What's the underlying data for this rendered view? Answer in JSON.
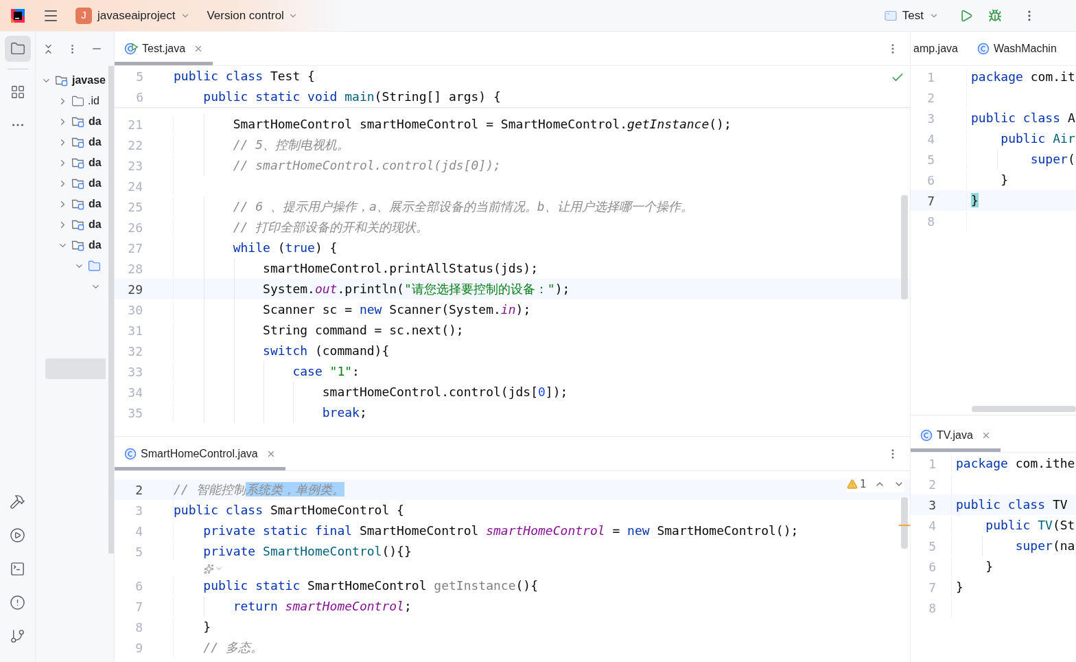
{
  "toolbar": {
    "project_badge": "J",
    "project": "javaseaiproject",
    "vcs": "Version control",
    "run_config": "Test"
  },
  "tool_windows": [
    {
      "kind": "project",
      "selected": true
    },
    {
      "kind": "structure",
      "selected": false
    },
    {
      "kind": "more",
      "selected": false
    }
  ],
  "bottom_tools": [
    {
      "kind": "build"
    },
    {
      "kind": "services"
    },
    {
      "kind": "terminal"
    },
    {
      "kind": "problems"
    },
    {
      "kind": "git"
    }
  ],
  "project_tree": {
    "highlight_row": true,
    "items": [
      {
        "label": "javase",
        "kind": "module",
        "expanded": true,
        "children": [
          {
            "label": ".id",
            "kind": "folder",
            "expanded": false
          },
          {
            "label": "da",
            "kind": "module",
            "expanded": false
          },
          {
            "label": "da",
            "kind": "module",
            "expanded": false
          },
          {
            "label": "da",
            "kind": "module",
            "expanded": false
          },
          {
            "label": "da",
            "kind": "module",
            "expanded": false
          },
          {
            "label": "da",
            "kind": "module",
            "expanded": false
          },
          {
            "label": "da",
            "kind": "module",
            "expanded": false
          },
          {
            "label": "da",
            "kind": "module",
            "expanded": true,
            "children": [
              {
                "kind": "source-folder",
                "expanded": true,
                "children": [
                  {
                    "kind": "chevron-only",
                    "expanded": true
                  }
                ]
              }
            ]
          }
        ]
      }
    ]
  },
  "editors": [
    {
      "tabs": [
        {
          "title": "Test.java",
          "kind": "runnable-class",
          "closable": true,
          "selected": true
        }
      ],
      "status": {
        "kind": "ok"
      },
      "sticky_lines": [
        {
          "number": "5",
          "tokens": [
            {
              "text": "public class ",
              "kind": "keyword"
            },
            {
              "text": "Test {",
              "kind": "plain"
            }
          ]
        },
        {
          "number": "6",
          "tokens": [
            {
              "text": "    public static void ",
              "kind": "keyword"
            },
            {
              "text": "main",
              "kind": "declaration"
            },
            {
              "text": "(String[] args) {",
              "kind": "plain"
            }
          ]
        }
      ],
      "lines": [
        {
          "kind": "code",
          "number": "21",
          "current": false,
          "tokens": [
            {
              "text": "        SmartHomeControl smartHomeControl = SmartHomeControl.",
              "kind": "plain"
            },
            {
              "text": "getInstance",
              "kind": "static-call"
            },
            {
              "text": "();",
              "kind": "plain"
            }
          ]
        },
        {
          "kind": "code",
          "number": "22",
          "current": false,
          "tokens": [
            {
              "text": "        // 5、控制电视机。",
              "kind": "comment"
            }
          ]
        },
        {
          "kind": "code",
          "number": "23",
          "current": false,
          "tokens": [
            {
              "text": "        // smartHomeControl.control(jds[0]);",
              "kind": "comment"
            }
          ]
        },
        {
          "kind": "code",
          "number": "24",
          "current": false
        },
        {
          "kind": "code",
          "number": "25",
          "current": false,
          "tokens": [
            {
              "text": "        // 6 、提示用户操作，a、展示全部设备的当前情况。b、让用户选择哪一个操作。",
              "kind": "comment"
            }
          ]
        },
        {
          "kind": "code",
          "number": "26",
          "current": false,
          "tokens": [
            {
              "text": "        // 打印全部设备的开和关的现状。",
              "kind": "comment"
            }
          ]
        },
        {
          "kind": "code",
          "number": "27",
          "current": false,
          "tokens": [
            {
              "text": "        while ",
              "kind": "keyword"
            },
            {
              "text": "(",
              "kind": "plain"
            },
            {
              "text": "true",
              "kind": "keyword"
            },
            {
              "text": ") {",
              "kind": "plain"
            }
          ]
        },
        {
          "kind": "code",
          "number": "28",
          "current": false,
          "tokens": [
            {
              "text": "            smartHomeControl.printAllStatus(jds);",
              "kind": "plain"
            }
          ]
        },
        {
          "kind": "code",
          "number": "29",
          "current": true,
          "tokens": [
            {
              "text": "            System.",
              "kind": "plain"
            },
            {
              "text": "out",
              "kind": "field"
            },
            {
              "text": ".println(",
              "kind": "plain"
            },
            {
              "text": "\"请您选择要控制的设备：\"",
              "kind": "string"
            },
            {
              "text": ");",
              "kind": "plain"
            }
          ]
        },
        {
          "kind": "code",
          "number": "30",
          "current": false,
          "tokens": [
            {
              "text": "            Scanner sc = ",
              "kind": "plain"
            },
            {
              "text": "new ",
              "kind": "keyword"
            },
            {
              "text": "Scanner(System.",
              "kind": "plain"
            },
            {
              "text": "in",
              "kind": "field"
            },
            {
              "text": ");",
              "kind": "plain"
            }
          ]
        },
        {
          "kind": "code",
          "number": "31",
          "current": false,
          "tokens": [
            {
              "text": "            String command = sc.next();",
              "kind": "plain"
            }
          ]
        },
        {
          "kind": "code",
          "number": "32",
          "current": false,
          "tokens": [
            {
              "text": "            switch ",
              "kind": "keyword"
            },
            {
              "text": "(command){",
              "kind": "plain"
            }
          ]
        },
        {
          "kind": "code",
          "number": "33",
          "current": false,
          "tokens": [
            {
              "text": "                case ",
              "kind": "keyword"
            },
            {
              "text": "\"1\"",
              "kind": "string"
            },
            {
              "text": ":",
              "kind": "plain"
            }
          ]
        },
        {
          "kind": "code",
          "number": "34",
          "current": false,
          "tokens": [
            {
              "text": "                    smartHomeControl.control(jds[",
              "kind": "plain"
            },
            {
              "text": "0",
              "kind": "number"
            },
            {
              "text": "]);",
              "kind": "plain"
            }
          ]
        },
        {
          "kind": "code",
          "number": "35",
          "current": false,
          "tokens": [
            {
              "text": "                    break",
              "kind": "keyword"
            },
            {
              "text": ";",
              "kind": "plain"
            }
          ]
        }
      ]
    },
    {
      "tabs": [
        {
          "title": "SmartHomeControl.java",
          "kind": "class",
          "closable": true,
          "selected": true
        }
      ],
      "status": {
        "kind": "warnings",
        "count": "1"
      },
      "lines": [
        {
          "kind": "code",
          "number": "2",
          "current": true,
          "tokens": [
            {
              "text": "// 智能控制",
              "kind": "comment"
            },
            {
              "text": "系统类，单例类。",
              "kind": "comment-selected"
            }
          ]
        },
        {
          "kind": "code",
          "number": "3",
          "current": false,
          "tokens": [
            {
              "text": "public class ",
              "kind": "keyword"
            },
            {
              "text": "SmartHomeControl {",
              "kind": "plain"
            }
          ]
        },
        {
          "kind": "code",
          "number": "4",
          "current": false,
          "tokens": [
            {
              "text": "    private static final ",
              "kind": "keyword"
            },
            {
              "text": "SmartHomeControl ",
              "kind": "plain"
            },
            {
              "text": "smartHomeControl",
              "kind": "field"
            },
            {
              "text": " = ",
              "kind": "plain"
            },
            {
              "text": "new ",
              "kind": "keyword"
            },
            {
              "text": "SmartHomeControl();",
              "kind": "plain"
            }
          ]
        },
        {
          "kind": "code",
          "number": "5",
          "current": false,
          "tokens": [
            {
              "text": "    private ",
              "kind": "keyword"
            },
            {
              "text": "SmartHomeControl",
              "kind": "declaration"
            },
            {
              "text": "(){}",
              "kind": "plain"
            }
          ]
        },
        {
          "kind": "inlay"
        },
        {
          "kind": "code",
          "number": "6",
          "current": false,
          "tokens": [
            {
              "text": "    public static ",
              "kind": "keyword"
            },
            {
              "text": "SmartHomeControl ",
              "kind": "plain"
            },
            {
              "text": "getInstance",
              "kind": "unused"
            },
            {
              "text": "(){",
              "kind": "plain"
            }
          ]
        },
        {
          "kind": "code",
          "number": "7",
          "current": false,
          "tokens": [
            {
              "text": "        return ",
              "kind": "keyword"
            },
            {
              "text": "smartHomeControl",
              "kind": "field"
            },
            {
              "text": ";",
              "kind": "plain"
            }
          ]
        },
        {
          "kind": "code",
          "number": "8",
          "current": false,
          "tokens": [
            {
              "text": "    }",
              "kind": "plain"
            }
          ]
        },
        {
          "kind": "code",
          "number": "9",
          "current": false,
          "tokens": [
            {
              "text": "    // 多态。",
              "kind": "comment"
            }
          ]
        }
      ]
    },
    {
      "tabs": [
        {
          "title": "amp.java",
          "kind": "plain",
          "closable": false,
          "selected": false
        },
        {
          "title": "WashMachin",
          "kind": "class",
          "closable": false,
          "selected": false
        }
      ],
      "lines": [
        {
          "kind": "code",
          "number": "1",
          "current": false,
          "tokens": [
            {
              "text": "package ",
              "kind": "keyword"
            },
            {
              "text": "com.it",
              "kind": "plain"
            }
          ]
        },
        {
          "kind": "code",
          "number": "2",
          "current": false
        },
        {
          "kind": "code",
          "number": "3",
          "current": false,
          "tokens": [
            {
              "text": "public class ",
              "kind": "keyword"
            },
            {
              "text": "A",
              "kind": "plain"
            }
          ]
        },
        {
          "kind": "code",
          "number": "4",
          "current": false,
          "tokens": [
            {
              "text": "    public ",
              "kind": "keyword"
            },
            {
              "text": "Air",
              "kind": "declaration"
            }
          ]
        },
        {
          "kind": "code",
          "number": "5",
          "current": false,
          "tokens": [
            {
              "text": "        super",
              "kind": "keyword"
            },
            {
              "text": "(",
              "kind": "plain"
            }
          ]
        },
        {
          "kind": "code",
          "number": "6",
          "current": false,
          "tokens": [
            {
              "text": "    }",
              "kind": "plain"
            }
          ]
        },
        {
          "kind": "code",
          "number": "7",
          "current": true,
          "tokens": [
            {
              "text": "}",
              "kind": "brace-match"
            }
          ]
        },
        {
          "kind": "code",
          "number": "8",
          "current": false
        }
      ]
    },
    {
      "tabs": [
        {
          "title": "TV.java",
          "kind": "class",
          "closable": true,
          "selected": true
        }
      ],
      "lines": [
        {
          "kind": "code",
          "number": "1",
          "current": false,
          "tokens": [
            {
              "text": "package ",
              "kind": "keyword"
            },
            {
              "text": "com.ithe",
              "kind": "plain"
            }
          ]
        },
        {
          "kind": "code",
          "number": "2",
          "current": false
        },
        {
          "kind": "code",
          "number": "3",
          "current": true,
          "tokens": [
            {
              "text": "public class ",
              "kind": "keyword"
            },
            {
              "text": "TV",
              "kind": "plain"
            }
          ]
        },
        {
          "kind": "code",
          "number": "4",
          "current": false,
          "tokens": [
            {
              "text": "    public ",
              "kind": "keyword"
            },
            {
              "text": "TV",
              "kind": "declaration"
            },
            {
              "text": "(St",
              "kind": "plain"
            }
          ]
        },
        {
          "kind": "code",
          "number": "5",
          "current": false,
          "tokens": [
            {
              "text": "        super",
              "kind": "keyword"
            },
            {
              "text": "(na",
              "kind": "plain"
            }
          ]
        },
        {
          "kind": "code",
          "number": "6",
          "current": false,
          "tokens": [
            {
              "text": "    }",
              "kind": "plain"
            }
          ]
        },
        {
          "kind": "code",
          "number": "7",
          "current": false,
          "tokens": [
            {
              "text": "}",
              "kind": "plain"
            }
          ]
        },
        {
          "kind": "code",
          "number": "8",
          "current": false
        }
      ]
    }
  ]
}
